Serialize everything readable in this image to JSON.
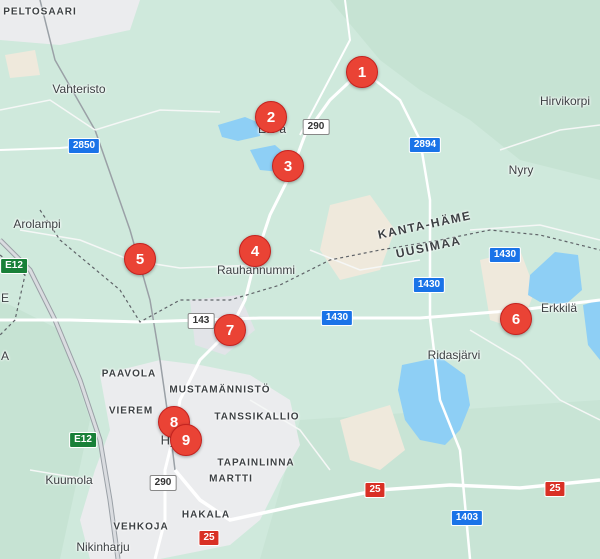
{
  "map": {
    "places": [
      {
        "id": "peltosaari",
        "label": "PELTOSAARI",
        "caps": true
      },
      {
        "id": "vahteristo",
        "label": "Vahteristo"
      },
      {
        "id": "hirvikorpi",
        "label": "Hirvikorpi"
      },
      {
        "id": "nyry",
        "label": "Nyry"
      },
      {
        "id": "arolampi",
        "label": "Arolampi"
      },
      {
        "id": "rauhannummi",
        "label": "Rauhannummi"
      },
      {
        "id": "erkkila",
        "label": "Erkkilä"
      },
      {
        "id": "ridasjarvi",
        "label": "Ridasjärvi"
      },
      {
        "id": "eteinen",
        "label": "Ete à"
      },
      {
        "id": "paavola",
        "label": "PAAVOLA",
        "caps": true
      },
      {
        "id": "mustamannisto",
        "label": "MUSTAMÄNNISTÖ",
        "caps": true
      },
      {
        "id": "vierema",
        "label": "VIEREM",
        "caps": true
      },
      {
        "id": "tanssikallio",
        "label": "TANSSIKALLIO",
        "caps": true
      },
      {
        "id": "hyvinkaa",
        "label": "Hy    ä"
      },
      {
        "id": "tapainlinna",
        "label": "TAPAINLINNA",
        "caps": true
      },
      {
        "id": "martti",
        "label": "MARTTI",
        "caps": true
      },
      {
        "id": "kuumola",
        "label": "Kuumola"
      },
      {
        "id": "hakala",
        "label": "HAKALA",
        "caps": true
      },
      {
        "id": "vehkoja",
        "label": "VEHKOJA",
        "caps": true
      },
      {
        "id": "nikinharju",
        "label": "Nikinharju"
      },
      {
        "id": "edge-a",
        "label": "A"
      },
      {
        "id": "edge-e",
        "label": "E"
      }
    ],
    "regions": [
      {
        "id": "kanta-hame",
        "label": "KANTA-HÄME"
      },
      {
        "id": "uusimaa",
        "label": "UUSIMAA"
      }
    ],
    "shields": [
      {
        "id": "r2850",
        "label": "2850",
        "style": "blue"
      },
      {
        "id": "r2894",
        "label": "2894",
        "style": "blue"
      },
      {
        "id": "r290a",
        "label": "290",
        "style": "white"
      },
      {
        "id": "r290b",
        "label": "290",
        "style": "white"
      },
      {
        "id": "r143",
        "label": "143",
        "style": "white"
      },
      {
        "id": "r1430a",
        "label": "1430",
        "style": "blue"
      },
      {
        "id": "r1430b",
        "label": "1430",
        "style": "blue"
      },
      {
        "id": "r1430c",
        "label": "1430",
        "style": "blue"
      },
      {
        "id": "r1403",
        "label": "1403",
        "style": "blue"
      },
      {
        "id": "r25a",
        "label": "25",
        "style": "red"
      },
      {
        "id": "r25b",
        "label": "25",
        "style": "red"
      },
      {
        "id": "r25c",
        "label": "25",
        "style": "red"
      },
      {
        "id": "e12a",
        "label": "E12",
        "style": "green"
      },
      {
        "id": "e12b",
        "label": "E12",
        "style": "green"
      }
    ],
    "markers": [
      {
        "id": "m1",
        "label": "1"
      },
      {
        "id": "m2",
        "label": "2"
      },
      {
        "id": "m3",
        "label": "3"
      },
      {
        "id": "m4",
        "label": "4"
      },
      {
        "id": "m5",
        "label": "5"
      },
      {
        "id": "m6",
        "label": "6"
      },
      {
        "id": "m7",
        "label": "7"
      },
      {
        "id": "m8",
        "label": "8"
      },
      {
        "id": "m9",
        "label": "9"
      }
    ],
    "colors": {
      "land": "#cfe9dc",
      "water": "#8ecff5",
      "urban": "#ebecee",
      "field": "#efe9dc",
      "marker": "#ea4335",
      "road": "#ffffff",
      "railway": "#9aa0a6"
    }
  }
}
